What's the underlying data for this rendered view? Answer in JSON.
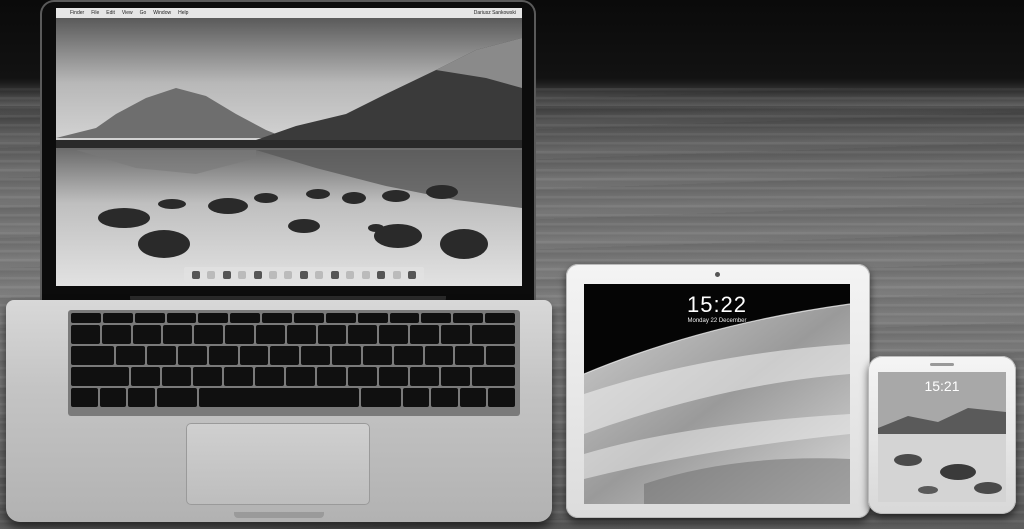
{
  "laptop": {
    "menubar": {
      "apple_symbol": "",
      "items": [
        "Finder",
        "File",
        "Edit",
        "View",
        "Go",
        "Window",
        "Help"
      ],
      "user": "Dariusz Sankowski"
    }
  },
  "tablet": {
    "lock_time": "15:22",
    "lock_date": "Monday 22 December"
  },
  "phone": {
    "lock_time": "15:21"
  },
  "colors": {
    "background": "#000000",
    "table": "#6f6f6f",
    "laptop_body": "#c4c4c4",
    "device_white": "#e6e6e6"
  }
}
